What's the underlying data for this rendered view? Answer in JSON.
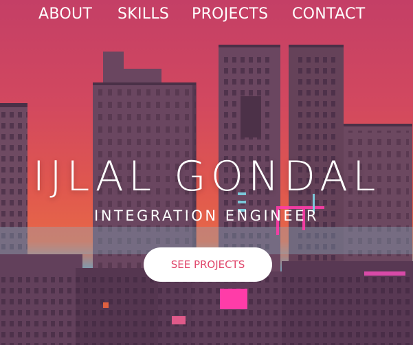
{
  "nav": {
    "items": [
      {
        "label": "ABOUT"
      },
      {
        "label": "SKILLS"
      },
      {
        "label": "PROJECTS"
      },
      {
        "label": "CONTACT"
      }
    ]
  },
  "hero": {
    "name": "IJLAL GONDAL",
    "role": "INTEGRATION ENGINEER",
    "cta_label": "SEE PROJECTS"
  },
  "colors": {
    "sky_top": "#c43f66",
    "sky_bottom": "#e76848",
    "cta_text": "#e0456a",
    "building": "#5a3a55",
    "neon": "#ff3ca8"
  }
}
